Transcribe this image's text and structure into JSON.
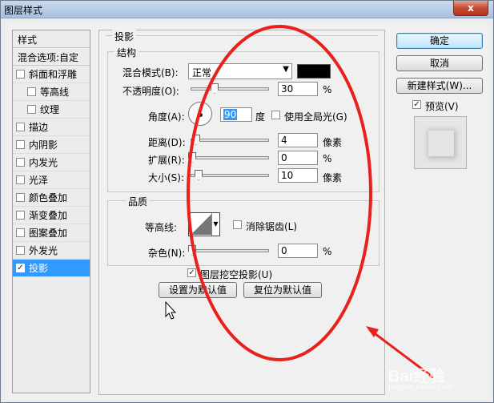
{
  "window": {
    "title": "图层样式",
    "close_glyph": "x"
  },
  "sidebar": {
    "header": "样式",
    "blend_options": "混合选项:自定",
    "items": [
      {
        "label": "斜面和浮雕",
        "checked": false,
        "sub": false
      },
      {
        "label": "等高线",
        "checked": false,
        "sub": true
      },
      {
        "label": "纹理",
        "checked": false,
        "sub": true
      },
      {
        "label": "描边",
        "checked": false,
        "sub": false
      },
      {
        "label": "内阴影",
        "checked": false,
        "sub": false
      },
      {
        "label": "内发光",
        "checked": false,
        "sub": false
      },
      {
        "label": "光泽",
        "checked": false,
        "sub": false
      },
      {
        "label": "颜色叠加",
        "checked": false,
        "sub": false
      },
      {
        "label": "渐变叠加",
        "checked": false,
        "sub": false
      },
      {
        "label": "图案叠加",
        "checked": false,
        "sub": false
      },
      {
        "label": "外发光",
        "checked": false,
        "sub": false
      },
      {
        "label": "投影",
        "checked": true,
        "sub": false,
        "active": true
      }
    ]
  },
  "drop_shadow": {
    "title": "投影",
    "structure": {
      "title": "结构",
      "blend_mode_label": "混合模式(B):",
      "blend_mode_value": "正常",
      "blend_color": "#000000",
      "opacity_label": "不透明度(O):",
      "opacity_value": "30",
      "opacity_unit": "%",
      "angle_label": "角度(A):",
      "angle_value": "90",
      "angle_unit": "度",
      "global_light_label": "使用全局光(G)",
      "global_light_checked": false,
      "distance_label": "距离(D):",
      "distance_value": "4",
      "distance_unit": "像素",
      "spread_label": "扩展(R):",
      "spread_value": "0",
      "spread_unit": "%",
      "size_label": "大小(S):",
      "size_value": "10",
      "size_unit": "像素"
    },
    "quality": {
      "title": "品质",
      "contour_label": "等高线:",
      "anti_alias_label": "消除锯齿(L)",
      "anti_alias_checked": false,
      "noise_label": "杂色(N):",
      "noise_value": "0",
      "noise_unit": "%"
    },
    "knockout_label": "图层挖空投影(U)",
    "knockout_checked": true,
    "make_default": "设置为默认值",
    "reset_default": "复位为默认值"
  },
  "right_buttons": {
    "ok": "确定",
    "cancel": "取消",
    "new_style": "新建样式(W)...",
    "preview_label": "预览(V)",
    "preview_checked": true
  },
  "watermark": {
    "brand": "Bai经验",
    "url": "jingyan.baidu.com"
  },
  "colors": {
    "annotation_red": "#e8211c",
    "selection_blue": "#3399ff"
  }
}
